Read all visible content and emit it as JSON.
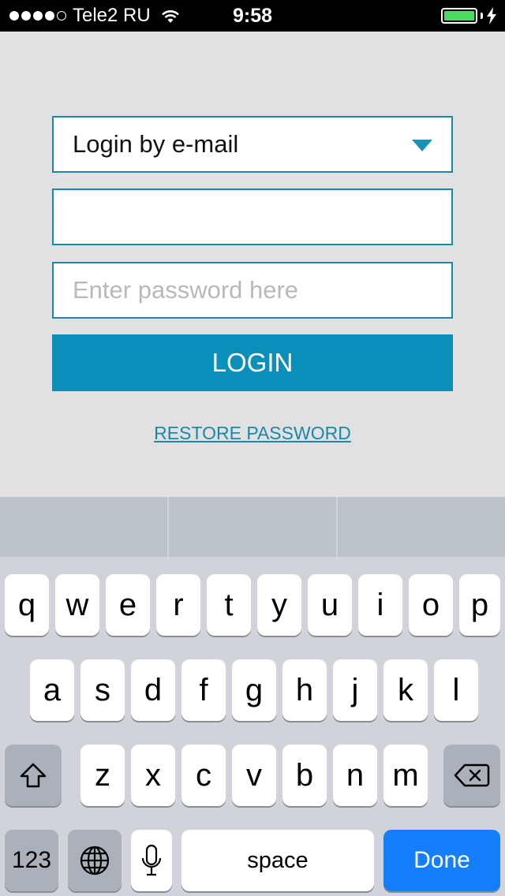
{
  "status_bar": {
    "carrier": "Tele2 RU",
    "time": "9:58",
    "signal_bars": 4,
    "signal_max": 5,
    "battery_color": "#4cd964"
  },
  "form": {
    "login_method": "Login by e-mail",
    "email": {
      "value": "",
      "placeholder": ""
    },
    "password": {
      "value": "",
      "placeholder": "Enter password here"
    },
    "login_button": "LOGIN",
    "restore_link": "RESTORE PASSWORD",
    "accent_color": "#0a8eba"
  },
  "keyboard": {
    "row1": [
      "q",
      "w",
      "e",
      "r",
      "t",
      "y",
      "u",
      "i",
      "o",
      "p"
    ],
    "row2": [
      "a",
      "s",
      "d",
      "f",
      "g",
      "h",
      "j",
      "k",
      "l"
    ],
    "row3": [
      "z",
      "x",
      "c",
      "v",
      "b",
      "n",
      "m"
    ],
    "shift_icon": "shift-icon",
    "delete_icon": "delete-icon",
    "num_label": "123",
    "globe_icon": "globe-icon",
    "mic_icon": "microphone-icon",
    "space_label": "space",
    "done_label": "Done"
  }
}
